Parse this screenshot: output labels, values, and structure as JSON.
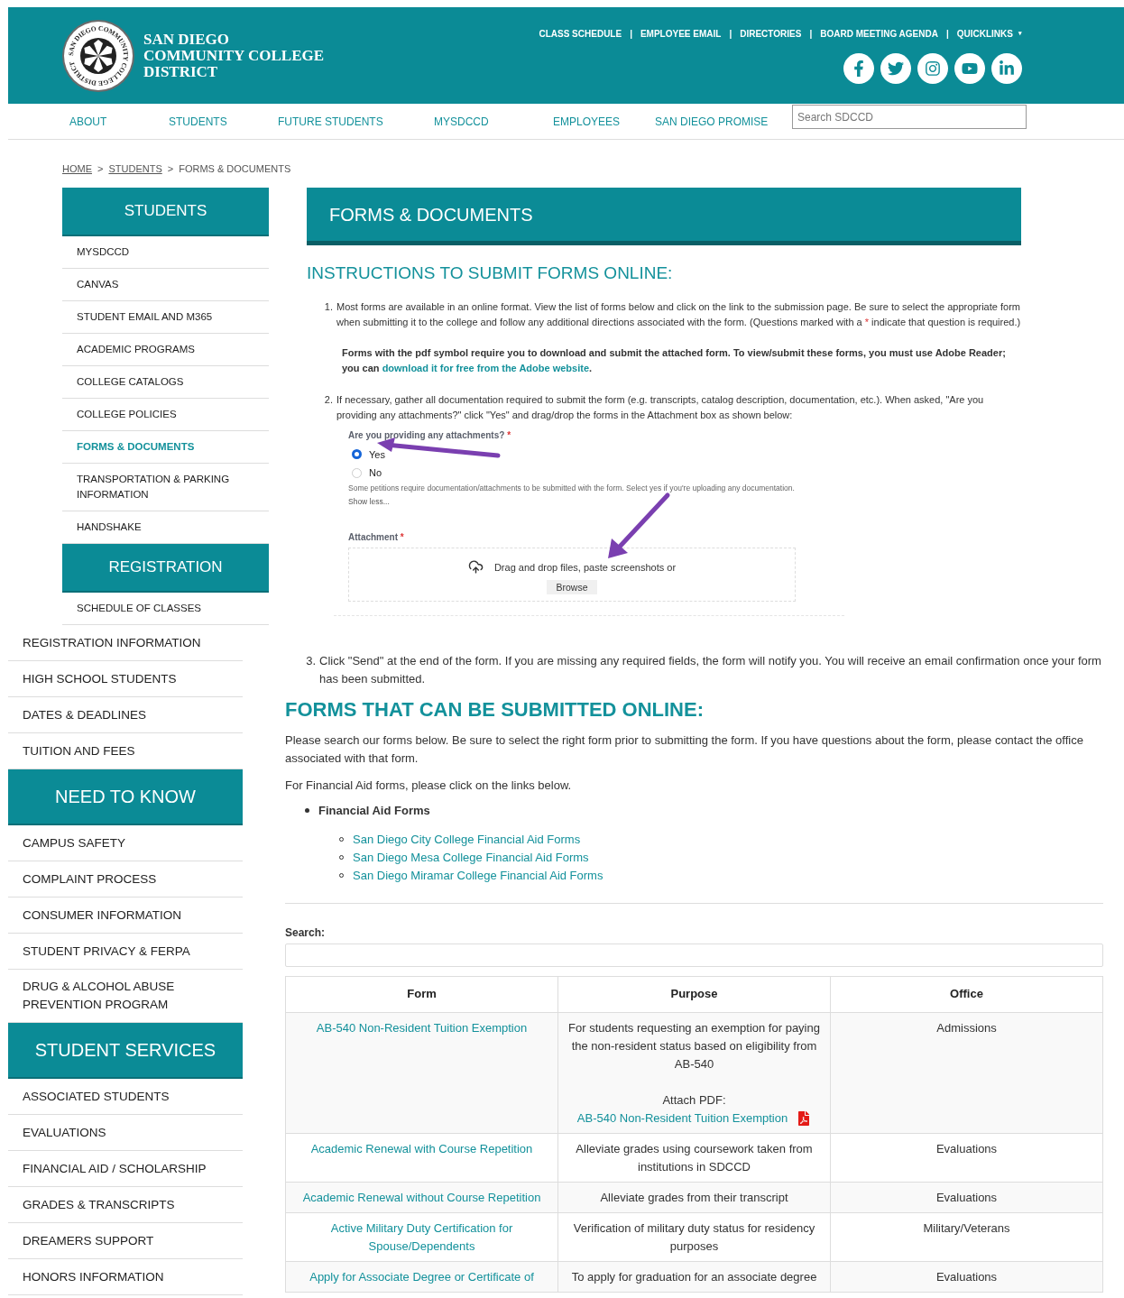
{
  "header": {
    "seal_text": "SAN DIEGO COMMUNITY COLLEGE DISTRICT",
    "logo_lines": [
      "SAN DIEGO",
      "COMMUNITY COLLEGE",
      "DISTRICT"
    ],
    "top_links": [
      "CLASS SCHEDULE",
      "EMPLOYEE EMAIL",
      "DIRECTORIES",
      "BOARD MEETING AGENDA"
    ],
    "separator": "|",
    "quicklinks": "QUICKLINKS",
    "quicklinks_caret": "▾"
  },
  "nav": {
    "items": [
      "ABOUT",
      "STUDENTS",
      "FUTURE STUDENTS",
      "MYSDCCD",
      "EMPLOYEES",
      "SAN DIEGO PROMISE"
    ],
    "search": {
      "placeholder": "Search SDCCD"
    }
  },
  "breadcrumb": {
    "separator": ">",
    "items": [
      {
        "label": "HOME",
        "link": true
      },
      {
        "label": "STUDENTS",
        "link": true
      },
      {
        "label": "FORMS & DOCUMENTS",
        "link": false
      }
    ]
  },
  "sidebar_upper": [
    {
      "kind": "header",
      "label": "STUDENTS"
    },
    {
      "kind": "item",
      "label": "MYSDCCD",
      "selected": false
    },
    {
      "kind": "item",
      "label": "CANVAS",
      "selected": false
    },
    {
      "kind": "item",
      "label": "STUDENT EMAIL AND M365",
      "selected": false
    },
    {
      "kind": "item",
      "label": "ACADEMIC PROGRAMS",
      "selected": false
    },
    {
      "kind": "item",
      "label": "COLLEGE CATALOGS",
      "selected": false
    },
    {
      "kind": "item",
      "label": "COLLEGE POLICIES",
      "selected": false
    },
    {
      "kind": "item",
      "label": "FORMS & DOCUMENTS",
      "selected": true
    },
    {
      "kind": "item",
      "label": "TRANSPORTATION & PARKING INFORMATION",
      "selected": false
    },
    {
      "kind": "item",
      "label": "HANDSHAKE",
      "selected": false
    },
    {
      "kind": "header",
      "label": "REGISTRATION"
    },
    {
      "kind": "item",
      "label": "SCHEDULE OF CLASSES",
      "selected": false
    }
  ],
  "sidebar_lower": [
    {
      "kind": "item",
      "label": "REGISTRATION INFORMATION",
      "selected": false
    },
    {
      "kind": "item",
      "label": "HIGH SCHOOL STUDENTS",
      "selected": false
    },
    {
      "kind": "item",
      "label": "DATES & DEADLINES",
      "selected": false
    },
    {
      "kind": "item",
      "label": "TUITION AND FEES",
      "selected": false
    },
    {
      "kind": "header",
      "label": "NEED TO KNOW"
    },
    {
      "kind": "item",
      "label": "CAMPUS SAFETY",
      "selected": false
    },
    {
      "kind": "item",
      "label": "COMPLAINT PROCESS",
      "selected": false
    },
    {
      "kind": "item",
      "label": "CONSUMER INFORMATION",
      "selected": false
    },
    {
      "kind": "item",
      "label": "STUDENT PRIVACY & FERPA",
      "selected": false
    },
    {
      "kind": "item",
      "label": "DRUG & ALCOHOL ABUSE PREVENTION PROGRAM",
      "selected": false
    },
    {
      "kind": "header",
      "label": "STUDENT SERVICES"
    },
    {
      "kind": "item",
      "label": "ASSOCIATED STUDENTS",
      "selected": false
    },
    {
      "kind": "item",
      "label": "EVALUATIONS",
      "selected": false
    },
    {
      "kind": "item",
      "label": "FINANCIAL AID / SCHOLARSHIP",
      "selected": false
    },
    {
      "kind": "item",
      "label": "GRADES & TRANSCRIPTS",
      "selected": false
    },
    {
      "kind": "item",
      "label": "DREAMERS SUPPORT",
      "selected": false
    },
    {
      "kind": "item",
      "label": "HONORS INFORMATION",
      "selected": false
    }
  ],
  "page_title": "FORMS & DOCUMENTS",
  "instructions": {
    "heading": "INSTRUCTIONS TO SUBMIT FORMS ONLINE:",
    "steps": [
      {
        "number": "1.",
        "paragraphs": [
          [
            {
              "kind": "plain",
              "text": "Most forms are available in an online format.  View the list of forms below and click on the link to the submission page.  Be sure to select the appropriate form when submitting it to the college and follow any additional directions associated with the form.  (Questions marked with a "
            },
            {
              "kind": "required",
              "text": "*"
            },
            {
              "kind": "plain",
              "text": " indicate that question is required.)"
            }
          ],
          [
            {
              "kind": "bold",
              "text": "Forms with the pdf symbol require you to download and submit the attached form.  To view/submit these forms, you must use Adobe Reader; you can "
            },
            {
              "kind": "link",
              "text": "download it for free from the Adobe website"
            },
            {
              "kind": "bold",
              "text": "."
            }
          ]
        ]
      },
      {
        "number": "2.",
        "paragraphs": [
          [
            {
              "kind": "plain",
              "text": "If necessary, gather all documentation required to submit the form (e.g. transcripts, catalog description, documentation, etc.).  When asked, \"Are you providing any attachments?\" click \"Yes\" and drag/drop the forms in the Attachment box as shown below:"
            }
          ]
        ]
      }
    ],
    "example_form": {
      "question": "Are you providing any attachments?",
      "required_mark": "*",
      "options": [
        {
          "label": "Yes",
          "selected": true
        },
        {
          "label": "No",
          "selected": false
        }
      ],
      "hint": "Some petitions require documentation/attachments to be submitted with the form. Select yes if you're uploading any documentation.",
      "toggle": "Show less...",
      "attachment_label": "Attachment",
      "drop_text": "Drag and drop files, paste screenshots or",
      "browse": "Browse"
    }
  },
  "step_3": {
    "number": "3.",
    "text": "Click \"Send\" at the end of the form.  If you are missing any required fields, the form will notify you.  You will receive an email confirmation once your form has been submitted."
  },
  "online_forms": {
    "heading": "FORMS THAT CAN BE SUBMITTED ONLINE:",
    "intro": "Please search our forms below.  Be sure to select the right form prior to submitting the form.  If you have questions about the form, please contact the office associated with that form.",
    "financial_note": "For Financial Aid forms, please click on the links below.",
    "list_title": "Financial Aid Forms",
    "links": [
      "San Diego City College Financial Aid Forms",
      "San Diego Mesa College Financial Aid Forms",
      "San Diego Miramar College Financial Aid Forms"
    ]
  },
  "search": {
    "label": "Search:"
  },
  "table": {
    "columns": [
      "Form",
      "Purpose",
      "Office"
    ],
    "rows": [
      {
        "form": "AB-540 Non-Resident Tuition Exemption",
        "purpose": "For students requesting an exemption for paying the non-resident status based on eligibility from AB-540",
        "attachment": {
          "prefix": "Attach PDF:",
          "link": "AB-540 Non-Resident Tuition Exemption"
        },
        "office": "Admissions"
      },
      {
        "form": "Academic Renewal with Course Repetition",
        "purpose": "Alleviate grades using coursework taken from institutions in SDCCD",
        "office": "Evaluations"
      },
      {
        "form": "Academic Renewal without Course Repetition",
        "purpose": "Alleviate grades from their transcript",
        "office": "Evaluations"
      },
      {
        "form": "Active Military Duty Certification for Spouse/Dependents",
        "purpose": "Verification of military duty status for residency purposes",
        "office": "Military/Veterans"
      },
      {
        "form": "Apply for Associate Degree or Certificate of",
        "purpose": "To apply for graduation for an associate degree",
        "office": "Evaluations"
      }
    ]
  }
}
